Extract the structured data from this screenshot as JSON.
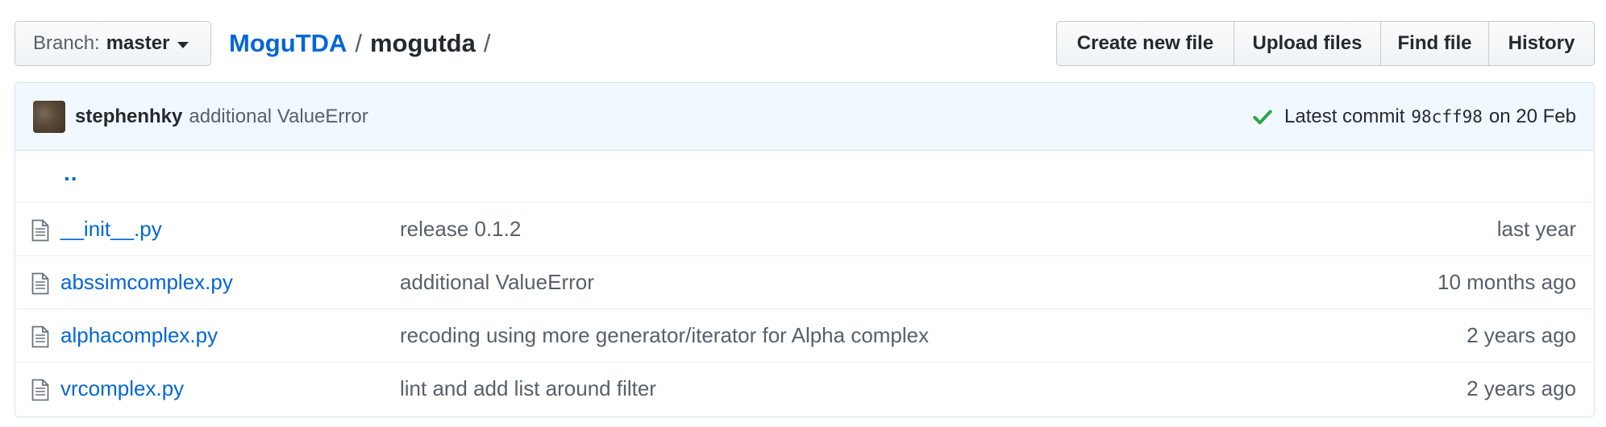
{
  "branch": {
    "prefix": "Branch:",
    "name": "master"
  },
  "breadcrumb": {
    "repo": "MoguTDA",
    "sep1": "/",
    "folder": "mogutda",
    "sep2": "/"
  },
  "actions": [
    {
      "label": "Create new file"
    },
    {
      "label": "Upload files"
    },
    {
      "label": "Find file"
    },
    {
      "label": "History"
    }
  ],
  "commit": {
    "author": "stephenhky",
    "message": "additional ValueError",
    "latest_label": "Latest commit",
    "sha": "98cff98",
    "date": "on 20 Feb",
    "status_color": "#28a745"
  },
  "parent_link": "..",
  "files": [
    {
      "name": "__init__.py",
      "message": "release 0.1.2",
      "age": "last year"
    },
    {
      "name": "abssimcomplex.py",
      "message": "additional ValueError",
      "age": "10 months ago"
    },
    {
      "name": "alphacomplex.py",
      "message": "recoding using more generator/iterator for Alpha complex",
      "age": "2 years ago"
    },
    {
      "name": "vrcomplex.py",
      "message": "lint and add list around filter",
      "age": "2 years ago"
    }
  ],
  "icons": {
    "file": "file-text-icon",
    "check": "check-icon",
    "caret": "caret-down-icon"
  },
  "colors": {
    "link": "#0366d6",
    "commit_bg": "#f1f8ff",
    "muted": "#586069"
  }
}
